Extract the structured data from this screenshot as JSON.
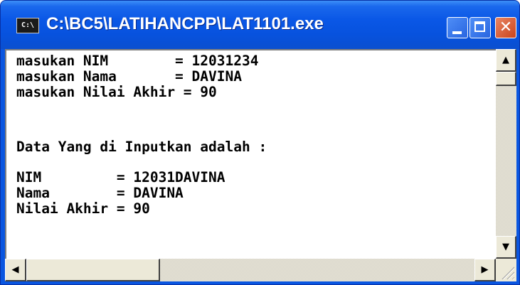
{
  "window": {
    "title": "C:\\BC5\\LATIHANCPP\\LAT1101.exe",
    "icon_text": "C:\\"
  },
  "console": {
    "lines": [
      "masukan NIM        = 12031234",
      "masukan Nama       = DAVINA",
      "masukan Nilai Akhir = 90",
      "",
      "",
      "Data Yang di Inputkan adalah :",
      "",
      "NIM         = 12031DAVINA",
      "Nama        = DAVINA",
      "Nilai Akhir = 90"
    ]
  },
  "icons": {
    "up": "scroll-up-arrow",
    "down": "scroll-down-arrow",
    "left": "scroll-left-arrow",
    "right": "scroll-right-arrow"
  },
  "colors": {
    "titlebar": "#0a57e6",
    "console_bg": "#ffffff",
    "console_text": "#000000",
    "close_button": "#c9431b"
  }
}
